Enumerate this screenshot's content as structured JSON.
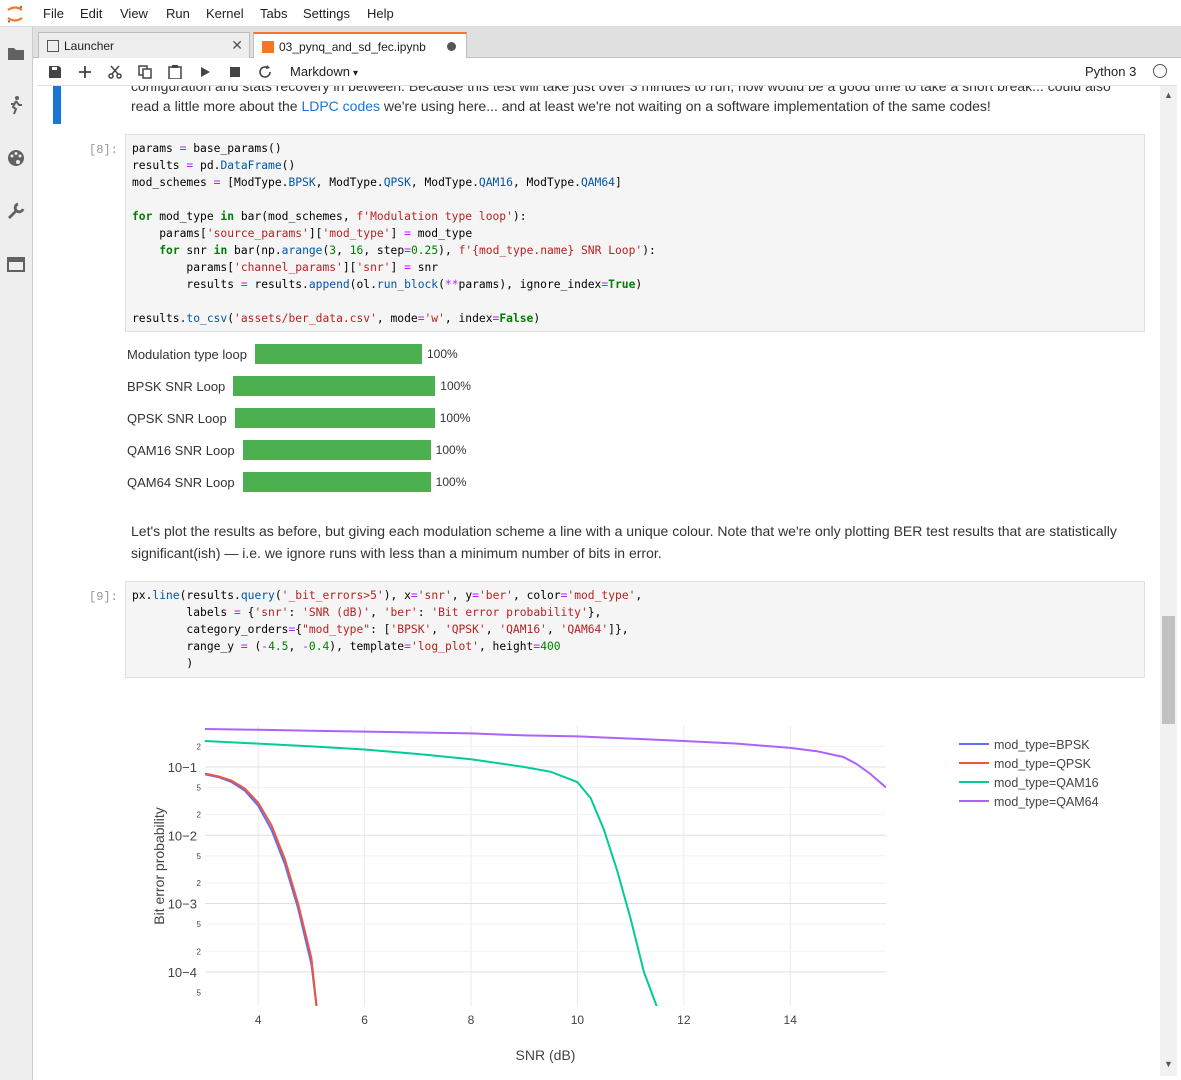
{
  "menu": [
    "File",
    "Edit",
    "View",
    "Run",
    "Kernel",
    "Tabs",
    "Settings",
    "Help"
  ],
  "tabs": [
    {
      "label": "Launcher"
    },
    {
      "label": "03_pynq_and_sd_fec.ipynb"
    }
  ],
  "toolbar": {
    "cell_type": "Markdown",
    "kernel": "Python 3"
  },
  "markdown1": {
    "line1": "configuration and stats recovery in between. Because this test will take just over 3 minutes to run, now would be a good time to take a short break... could also",
    "line2_pre": "read a little more about the ",
    "link": "LDPC codes",
    "line2_post": " we're using here... and at least we're not waiting on a software implementation of the same codes!"
  },
  "cell8": {
    "prompt": "[8]:"
  },
  "progress": [
    {
      "label": "Modulation type loop",
      "pct": "100%"
    },
    {
      "label": "BPSK SNR Loop",
      "pct": "100%"
    },
    {
      "label": "QPSK SNR Loop",
      "pct": "100%"
    },
    {
      "label": "QAM16 SNR Loop",
      "pct": "100%"
    },
    {
      "label": "QAM64 SNR Loop",
      "pct": "100%"
    }
  ],
  "markdown2": {
    "line1": "Let's plot the results as before, but giving each modulation scheme a line with a unique colour. Note that we're only plotting BER test results that are statistically",
    "line2": "significant(ish) — i.e. we ignore runs with less than a minimum number of bits in error."
  },
  "cell9": {
    "prompt": "[9]:"
  },
  "chart_data": {
    "type": "line",
    "xlabel": "SNR (dB)",
    "ylabel": "Bit error probability",
    "xlim": [
      3,
      15.8
    ],
    "ylim": [
      -4.5,
      -0.4
    ],
    "yscale": "log",
    "x_ticks": [
      "4",
      "6",
      "8",
      "10",
      "12",
      "14"
    ],
    "y_ticks": [
      "10−1",
      "10−2",
      "10−3",
      "10−4"
    ],
    "minor_ticks": [
      "2",
      "5"
    ],
    "legend_position": "top-right",
    "series": [
      {
        "name": "mod_type=BPSK",
        "color": "#636efa",
        "x": [
          3,
          3.25,
          3.5,
          3.75,
          4,
          4.25,
          4.5,
          4.75,
          5,
          5.1
        ],
        "y": [
          0.078,
          0.071,
          0.06,
          0.045,
          0.027,
          0.012,
          0.0038,
          0.00085,
          0.00013,
          3e-05
        ]
      },
      {
        "name": "mod_type=QPSK",
        "color": "#ef553b",
        "x": [
          3,
          3.25,
          3.5,
          3.75,
          4,
          4.25,
          4.5,
          4.75,
          5,
          5.1
        ],
        "y": [
          0.08,
          0.073,
          0.063,
          0.048,
          0.03,
          0.014,
          0.0045,
          0.001,
          0.00016,
          3e-05
        ]
      },
      {
        "name": "mod_type=QAM16",
        "color": "#00cc96",
        "x": [
          3,
          4,
          5,
          6,
          7,
          8,
          9,
          9.5,
          10,
          10.25,
          10.5,
          10.75,
          11,
          11.25,
          11.5
        ],
        "y": [
          0.24,
          0.22,
          0.2,
          0.18,
          0.155,
          0.13,
          0.1,
          0.085,
          0.06,
          0.035,
          0.012,
          0.003,
          0.0006,
          0.0001,
          3e-05
        ]
      },
      {
        "name": "mod_type=QAM64",
        "color": "#ab63fa",
        "x": [
          3,
          4,
          5,
          6,
          7,
          8,
          9,
          10,
          11,
          12,
          13,
          14,
          14.5,
          15,
          15.25,
          15.5,
          15.8
        ],
        "y": [
          0.36,
          0.35,
          0.34,
          0.33,
          0.32,
          0.31,
          0.29,
          0.28,
          0.26,
          0.24,
          0.22,
          0.19,
          0.17,
          0.14,
          0.11,
          0.08,
          0.05
        ]
      }
    ]
  }
}
